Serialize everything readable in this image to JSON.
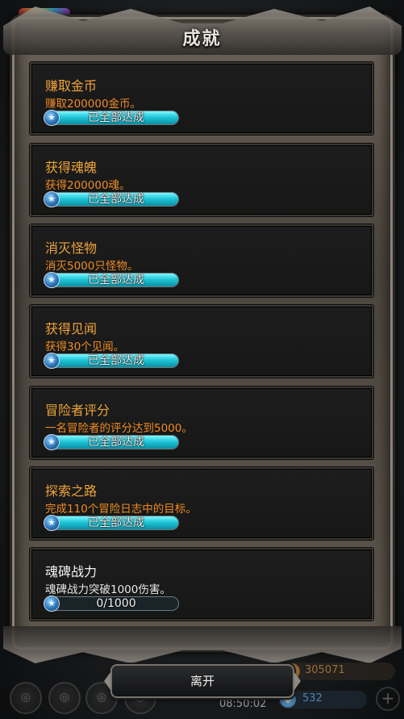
{
  "title": "成就",
  "achievements": [
    {
      "name": "赚取金币",
      "desc": "赚取200000金币。",
      "status": "已全部达成",
      "progress": 1.0,
      "completed": true
    },
    {
      "name": "获得魂魄",
      "desc": "获得200000魂。",
      "status": "已全部达成",
      "progress": 1.0,
      "completed": true
    },
    {
      "name": "消灭怪物",
      "desc": "消灭5000只怪物。",
      "status": "已全部达成",
      "progress": 1.0,
      "completed": true
    },
    {
      "name": "获得见闻",
      "desc": "获得30个见闻。",
      "status": "已全部达成",
      "progress": 1.0,
      "completed": true
    },
    {
      "name": "冒险者评分",
      "desc": "一名冒险者的评分达到5000。",
      "status": "已全部达成",
      "progress": 1.0,
      "completed": true
    },
    {
      "name": "探索之路",
      "desc": "完成110个冒险日志中的目标。",
      "status": "已全部达成",
      "progress": 1.0,
      "completed": true
    },
    {
      "name": "魂碑战力",
      "desc": "魂碑战力突破1000伤害。",
      "status": "0/1000",
      "progress": 0.0,
      "completed": false
    }
  ],
  "leave_label": "离开",
  "hud": {
    "gold": "305071",
    "time": "08:50:02",
    "gems": "532"
  },
  "icons": {
    "medal": "star-medal-icon",
    "coin": "gold-coin-icon",
    "gem": "blue-gem-icon",
    "plus": "plus-icon"
  }
}
